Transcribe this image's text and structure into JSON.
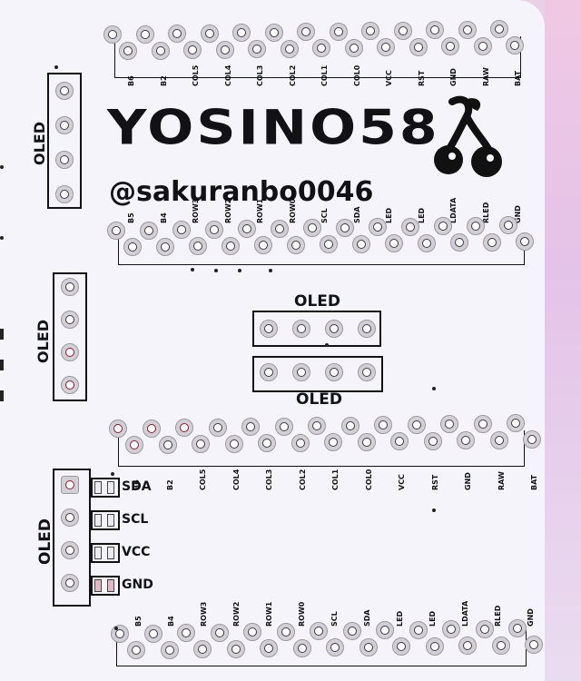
{
  "brand": {
    "logo_text": "YOSINO58",
    "handle": "@sakuranbo0046"
  },
  "oled_label": "OLED",
  "headers": {
    "top_labels": [
      "B6",
      "B2",
      "COL5",
      "COL4",
      "COL3",
      "COL2",
      "COL1",
      "COL0",
      "VCC",
      "RST",
      "GND",
      "RAW",
      "BAT"
    ],
    "bottom_labels": [
      "B5",
      "B4",
      "ROW3",
      "ROW2",
      "ROW1",
      "ROW0",
      "SCL",
      "SDA",
      "LED",
      "LED",
      "LDATA",
      "RLED",
      "GND"
    ]
  },
  "pin_labels": {
    "sda": "SDA",
    "scl": "SCL",
    "vcc": "VCC",
    "gnd": "GND"
  },
  "colors": {
    "board": "#f6f4fb",
    "silkscreen": "#111118",
    "pad": "#d2d0d6",
    "background": "#e8d0e6"
  },
  "icons": {
    "logo_mark": "cherry-icon"
  }
}
